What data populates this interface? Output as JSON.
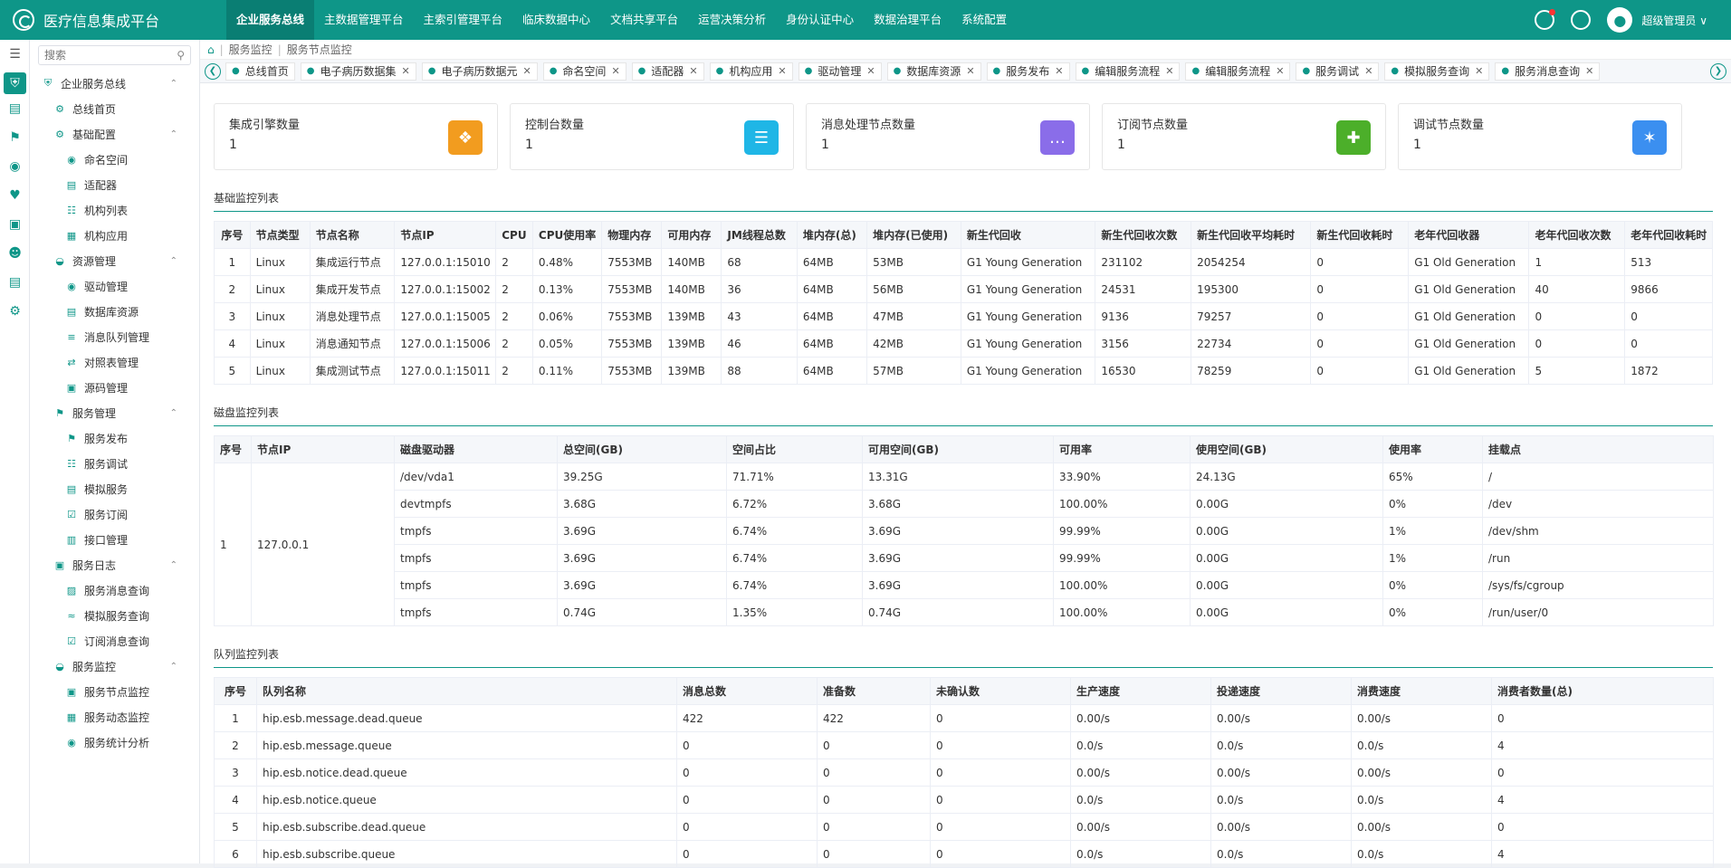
{
  "app": {
    "title": "医疗信息集成平台"
  },
  "topnav": [
    "企业服务总线",
    "主数据管理平台",
    "主索引管理平台",
    "临床数据中心",
    "文档共享平台",
    "运营决策分析",
    "身份认证中心",
    "数据治理平台",
    "系统配置"
  ],
  "user": {
    "name": "超级管理员 ∨"
  },
  "search": {
    "placeholder": "搜索"
  },
  "sidebar": [
    {
      "level": 1,
      "label": "企业服务总线",
      "icon": "shield-icon",
      "chev": "^"
    },
    {
      "level": 2,
      "label": "总线首页",
      "icon": "gear-icon"
    },
    {
      "level": 2,
      "label": "基础配置",
      "icon": "gear-icon",
      "chev": "^"
    },
    {
      "level": 3,
      "label": "命名空间",
      "icon": "namespace-icon"
    },
    {
      "level": 3,
      "label": "适配器",
      "icon": "adapter-icon"
    },
    {
      "level": 3,
      "label": "机构列表",
      "icon": "org-tree-icon"
    },
    {
      "level": 3,
      "label": "机构应用",
      "icon": "grid-icon"
    },
    {
      "level": 2,
      "label": "资源管理",
      "icon": "resource-icon",
      "chev": "^"
    },
    {
      "level": 3,
      "label": "驱动管理",
      "icon": "driver-icon"
    },
    {
      "level": 3,
      "label": "数据库资源",
      "icon": "database-icon"
    },
    {
      "level": 3,
      "label": "消息队列管理",
      "icon": "queue-icon"
    },
    {
      "level": 3,
      "label": "对照表管理",
      "icon": "compare-icon"
    },
    {
      "level": 3,
      "label": "源码管理",
      "icon": "code-icon"
    },
    {
      "level": 2,
      "label": "服务管理",
      "icon": "bookmark-icon",
      "chev": "^"
    },
    {
      "level": 3,
      "label": "服务发布",
      "icon": "publish-icon"
    },
    {
      "level": 3,
      "label": "服务调试",
      "icon": "debug-icon"
    },
    {
      "level": 3,
      "label": "模拟服务",
      "icon": "mock-icon"
    },
    {
      "level": 3,
      "label": "服务订阅",
      "icon": "subscribe-icon"
    },
    {
      "level": 3,
      "label": "接口管理",
      "icon": "interface-icon"
    },
    {
      "level": 2,
      "label": "服务日志",
      "icon": "log-icon",
      "chev": "^"
    },
    {
      "level": 3,
      "label": "服务消息查询",
      "icon": "message-search-icon"
    },
    {
      "level": 3,
      "label": "模拟服务查询",
      "icon": "chart-icon"
    },
    {
      "level": 3,
      "label": "订阅消息查询",
      "icon": "subscribe-search-icon"
    },
    {
      "level": 2,
      "label": "服务监控",
      "icon": "monitor-icon",
      "chev": "^"
    },
    {
      "level": 3,
      "label": "服务节点监控",
      "icon": "node-monitor-icon"
    },
    {
      "level": 3,
      "label": "服务动态监控",
      "icon": "dynamic-monitor-icon"
    },
    {
      "level": 3,
      "label": "服务统计分析",
      "icon": "stats-icon"
    }
  ],
  "breadcrumb": [
    "服务监控",
    "服务节点监控"
  ],
  "tabs": [
    "总线首页",
    "电子病历数据集",
    "电子病历数据元",
    "命名空间",
    "适配器",
    "机构应用",
    "驱动管理",
    "数据库资源",
    "服务发布",
    "编辑服务流程",
    "编辑服务流程",
    "服务调试",
    "模拟服务查询",
    "服务消息查询"
  ],
  "cards": [
    {
      "title": "集成引擎数量",
      "value": "1",
      "color": "#f29c1f",
      "icon": "engine-icon"
    },
    {
      "title": "控制台数量",
      "value": "1",
      "color": "#1fb6e6",
      "icon": "console-icon"
    },
    {
      "title": "消息处理节点数量",
      "value": "1",
      "color": "#8a6de9",
      "icon": "message-icon"
    },
    {
      "title": "订阅节点数量",
      "value": "1",
      "color": "#4caf2a",
      "icon": "subscribe-node-icon"
    },
    {
      "title": "调试节点数量",
      "value": "1",
      "color": "#3b8ff0",
      "icon": "bug-icon"
    }
  ],
  "basic": {
    "title": "基础监控列表",
    "headers": [
      "序号",
      "节点类型",
      "节点名称",
      "节点IP",
      "CPU",
      "CPU使用率",
      "物理内存",
      "可用内存",
      "JM线程总数",
      "堆内存(总)",
      "堆内存(已使用)",
      "新生代回收",
      "新生代回收次数",
      "新生代回收平均耗时",
      "新生代回收耗时",
      "老年代回收器",
      "老年代回收次数",
      "老年代回收耗时"
    ],
    "rows": [
      [
        "1",
        "Linux",
        "集成运行节点",
        "127.0.0.1:15010",
        "2",
        "0.48%",
        "7553MB",
        "140MB",
        "68",
        "64MB",
        "53MB",
        "G1 Young Generation",
        "231102",
        "2054254",
        "0",
        "G1 Old Generation",
        "1",
        "513"
      ],
      [
        "2",
        "Linux",
        "集成开发节点",
        "127.0.0.1:15002",
        "2",
        "0.13%",
        "7553MB",
        "140MB",
        "36",
        "64MB",
        "56MB",
        "G1 Young Generation",
        "24531",
        "195300",
        "0",
        "G1 Old Generation",
        "40",
        "9866"
      ],
      [
        "3",
        "Linux",
        "消息处理节点",
        "127.0.0.1:15005",
        "2",
        "0.06%",
        "7553MB",
        "139MB",
        "43",
        "64MB",
        "47MB",
        "G1 Young Generation",
        "9136",
        "79257",
        "0",
        "G1 Old Generation",
        "0",
        "0"
      ],
      [
        "4",
        "Linux",
        "消息通知节点",
        "127.0.0.1:15006",
        "2",
        "0.05%",
        "7553MB",
        "139MB",
        "46",
        "64MB",
        "42MB",
        "G1 Young Generation",
        "3156",
        "22734",
        "0",
        "G1 Old Generation",
        "0",
        "0"
      ],
      [
        "5",
        "Linux",
        "集成测试节点",
        "127.0.0.1:15011",
        "2",
        "0.11%",
        "7553MB",
        "139MB",
        "88",
        "64MB",
        "57MB",
        "G1 Young Generation",
        "16530",
        "78259",
        "0",
        "G1 Old Generation",
        "5",
        "1872"
      ]
    ]
  },
  "disk": {
    "title": "磁盘监控列表",
    "headers": [
      "序号",
      "节点IP",
      "磁盘驱动器",
      "总空间(GB)",
      "空间占比",
      "可用空间(GB)",
      "可用率",
      "使用空间(GB)",
      "使用率",
      "挂载点"
    ],
    "index": "1",
    "ip": "127.0.0.1",
    "rows": [
      [
        "/dev/vda1",
        "39.25G",
        "71.71%",
        "13.31G",
        "33.90%",
        "24.13G",
        "65%",
        "/"
      ],
      [
        "devtmpfs",
        "3.68G",
        "6.72%",
        "3.68G",
        "100.00%",
        "0.00G",
        "0%",
        "/dev"
      ],
      [
        "tmpfs",
        "3.69G",
        "6.74%",
        "3.69G",
        "99.99%",
        "0.00G",
        "1%",
        "/dev/shm"
      ],
      [
        "tmpfs",
        "3.69G",
        "6.74%",
        "3.69G",
        "99.99%",
        "0.00G",
        "1%",
        "/run"
      ],
      [
        "tmpfs",
        "3.69G",
        "6.74%",
        "3.69G",
        "100.00%",
        "0.00G",
        "0%",
        "/sys/fs/cgroup"
      ],
      [
        "tmpfs",
        "0.74G",
        "1.35%",
        "0.74G",
        "100.00%",
        "0.00G",
        "0%",
        "/run/user/0"
      ]
    ]
  },
  "queue": {
    "title": "队列监控列表",
    "headers": [
      "序号",
      "队列名称",
      "消息总数",
      "准备数",
      "未确认数",
      "生产速度",
      "投递速度",
      "消费速度",
      "消费者数量(总)"
    ],
    "rows": [
      [
        "1",
        "hip.esb.message.dead.queue",
        "422",
        "422",
        "0",
        "0.00/s",
        "0.00/s",
        "0.00/s",
        "0"
      ],
      [
        "2",
        "hip.esb.message.queue",
        "0",
        "0",
        "0",
        "0.0/s",
        "0.0/s",
        "0.0/s",
        "4"
      ],
      [
        "3",
        "hip.esb.notice.dead.queue",
        "0",
        "0",
        "0",
        "0.00/s",
        "0.00/s",
        "0.00/s",
        "0"
      ],
      [
        "4",
        "hip.esb.notice.queue",
        "0",
        "0",
        "0",
        "0.0/s",
        "0.0/s",
        "0.0/s",
        "4"
      ],
      [
        "5",
        "hip.esb.subscribe.dead.queue",
        "0",
        "0",
        "0",
        "0.00/s",
        "0.00/s",
        "0.00/s",
        "0"
      ],
      [
        "6",
        "hip.esb.subscribe.queue",
        "0",
        "0",
        "0",
        "0.0/s",
        "0.0/s",
        "0.0/s",
        "4"
      ]
    ]
  }
}
